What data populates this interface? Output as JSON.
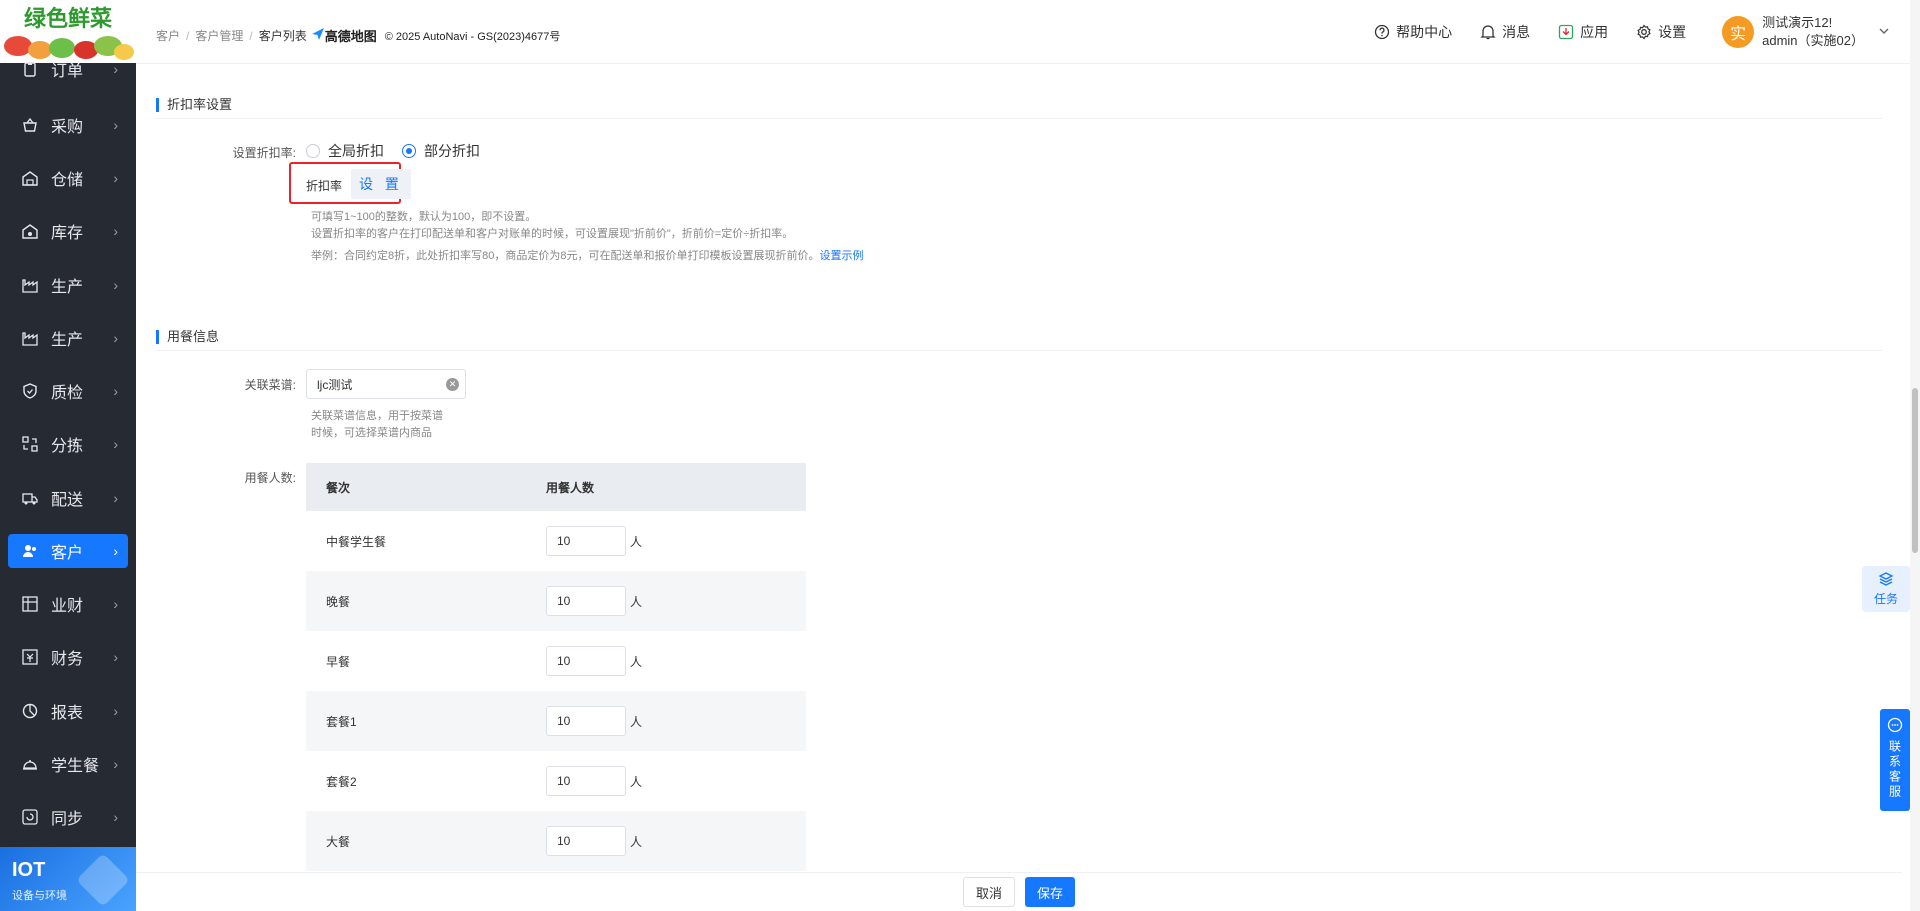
{
  "brand": {
    "logo_text": "绿色鲜菜"
  },
  "sidebar": {
    "items": [
      {
        "label": "订单",
        "icon": "clipboard-icon"
      },
      {
        "label": "采购",
        "icon": "basket-icon"
      },
      {
        "label": "仓储",
        "icon": "warehouse-icon"
      },
      {
        "label": "库存",
        "icon": "inventory-icon"
      },
      {
        "label": "生产",
        "icon": "factory-icon"
      },
      {
        "label": "生产",
        "icon": "factory-icon"
      },
      {
        "label": "质检",
        "icon": "shield-check-icon"
      },
      {
        "label": "分拣",
        "icon": "sort-icon"
      },
      {
        "label": "配送",
        "icon": "truck-icon"
      },
      {
        "label": "客户",
        "icon": "user-icon"
      },
      {
        "label": "业财",
        "icon": "finance-grid-icon"
      },
      {
        "label": "财务",
        "icon": "ledger-icon"
      },
      {
        "label": "报表",
        "icon": "pie-chart-icon"
      },
      {
        "label": "学生餐",
        "icon": "dish-cover-icon"
      },
      {
        "label": "同步",
        "icon": "sync-icon"
      }
    ],
    "active_index": 9,
    "iot": {
      "title": "IOT",
      "subtitle": "设备与环境"
    }
  },
  "header": {
    "breadcrumb": [
      "客户",
      "客户管理",
      "客户列表"
    ],
    "amap": {
      "logo": "高德地图",
      "copyright": "© 2025 AutoNavi - GS(2023)4677号"
    },
    "links": {
      "help": "帮助中心",
      "messages": "消息",
      "apps": "应用",
      "settings": "设置"
    },
    "user": {
      "avatar": "实",
      "name": "测试演示12!",
      "account": "admin（实施02）"
    }
  },
  "discount": {
    "section_title": "折扣率设置",
    "label": "设置折扣率:",
    "options": [
      "全局折扣",
      "部分折扣"
    ],
    "selected": "部分折扣",
    "rate_label": "折扣率",
    "set_button": "设 置",
    "hint1": "可填写1~100的整数，默认为100，即不设置。",
    "hint2": "设置折扣率的客户在打印配送单和客户对账单的时候，可设置展现\"折前价\"，折前价=定价÷折扣率。",
    "hint3": "举例：合同约定8折，此处折扣率写80，商品定价为8元，可在配送单和报价单打印模板设置展现折前价。",
    "hint3_link": "设置示例"
  },
  "meal": {
    "section_title": "用餐信息",
    "recipe_label": "关联菜谱:",
    "recipe_value": "ljc测试",
    "recipe_hint1": "关联菜谱信息，用于按菜谱",
    "recipe_hint2": "时候，可选择菜谱内商品",
    "count_label": "用餐人数:",
    "columns": [
      "餐次",
      "用餐人数"
    ],
    "unit": "人",
    "rows": [
      {
        "name": "中餐学生餐",
        "count": "10"
      },
      {
        "name": "晚餐",
        "count": "10"
      },
      {
        "name": "早餐",
        "count": "10"
      },
      {
        "name": "套餐1",
        "count": "10"
      },
      {
        "name": "套餐2",
        "count": "10"
      },
      {
        "name": "大餐",
        "count": "10"
      }
    ]
  },
  "footer": {
    "cancel": "取消",
    "save": "保存"
  },
  "floating": {
    "task": "任务",
    "service": "联系客服"
  },
  "colors": {
    "primary": "#1677ff",
    "sidebar_bg": "#262a33",
    "highlight": "#e8242c",
    "avatar": "#f59a23"
  }
}
